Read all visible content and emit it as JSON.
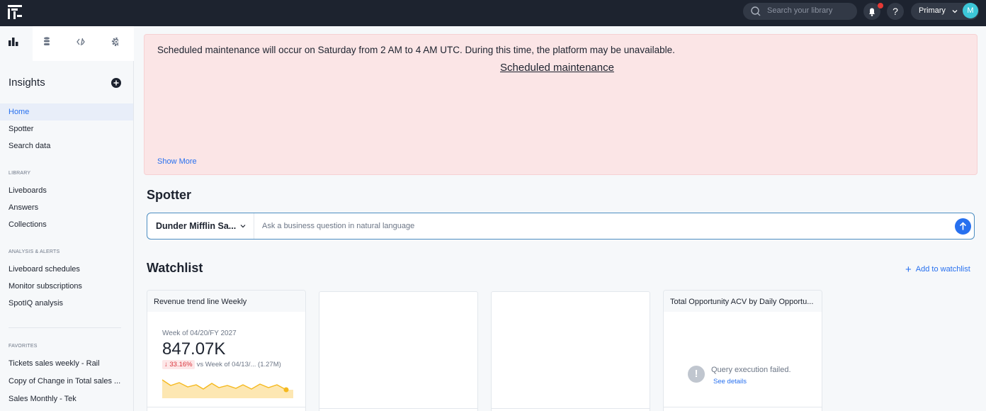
{
  "topbar": {
    "search_placeholder": "Search your library",
    "help_label": "?",
    "org_label": "Primary",
    "avatar_initial": "M"
  },
  "sidebar": {
    "title": "Insights",
    "nav": [
      "Home",
      "Spotter",
      "Search data"
    ],
    "library_heading": "LIBRARY",
    "library": [
      "Liveboards",
      "Answers",
      "Collections"
    ],
    "analysis_heading": "ANALYSIS & ALERTS",
    "analysis": [
      "Liveboard schedules",
      "Monitor subscriptions",
      "SpotIQ analysis"
    ],
    "favorites_heading": "FAVORITES",
    "favorites": [
      "Tickets sales weekly - Rail",
      "Copy of Change in Total sales ...",
      "Sales Monthly - Tek"
    ]
  },
  "banner": {
    "message": "Scheduled maintenance will occur on Saturday from 2 AM to 4 AM UTC. During this time, the platform may be unavailable.",
    "link": "Scheduled maintenance",
    "show_more": "Show More"
  },
  "spotter": {
    "heading": "Spotter",
    "datasource": "Dunder Mifflin Sa...",
    "placeholder": "Ask a business question in natural language"
  },
  "watchlist": {
    "heading": "Watchlist",
    "add_label": "Add to watchlist",
    "cards": [
      {
        "title": "Revenue trend line Weekly",
        "period": "Week of 04/20/FY 2027",
        "value": "847.07K",
        "change_pct": "33.16%",
        "comparison": "vs Week of 04/13/... (1.27M)"
      },
      {
        "title": ""
      },
      {
        "title": ""
      },
      {
        "title": "Total Opportunity ACV by Daily Opportu...",
        "error": "Query execution failed.",
        "error_link": "See details"
      }
    ]
  },
  "colors": {
    "topbar": "#1d232f",
    "accent": "#2770ef",
    "banner": "#fbe5e6",
    "negative": "#d9333b",
    "spark": "#f5b91f"
  }
}
